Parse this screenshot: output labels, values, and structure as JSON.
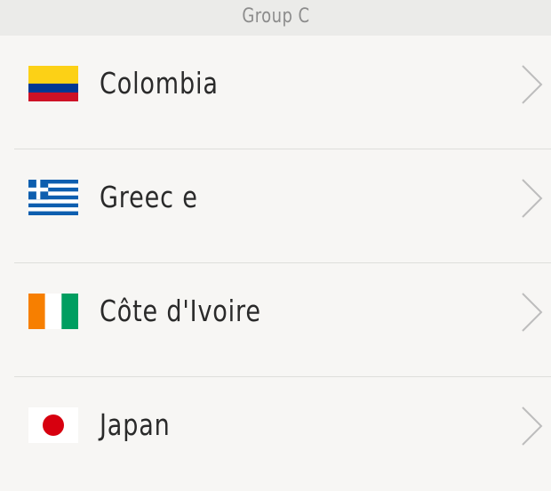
{
  "header": {
    "title": "Group C"
  },
  "teams": [
    {
      "name": "Colombia",
      "flag_icon": "colombia-flag-icon",
      "colors": [
        "#fcd116",
        "#003893",
        "#ce1126"
      ]
    },
    {
      "name": "Greec e",
      "flag_icon": "greece-flag-icon",
      "colors": [
        "#0d5eaf",
        "#ffffff"
      ]
    },
    {
      "name": "Côte d'Ivoire",
      "flag_icon": "ivory-coast-flag-icon",
      "colors": [
        "#f77f00",
        "#ffffff",
        "#009e60"
      ]
    },
    {
      "name": "Japan",
      "flag_icon": "japan-flag-icon",
      "colors": [
        "#ffffff",
        "#d7000f"
      ]
    }
  ],
  "chevron_icon": "chevron-right-icon",
  "colors": {
    "background": "#f7f6f4",
    "header_bg": "#ebebe9",
    "header_text": "#8c8c8c",
    "divider": "#dededb",
    "chevron": "#bdbdbd"
  }
}
